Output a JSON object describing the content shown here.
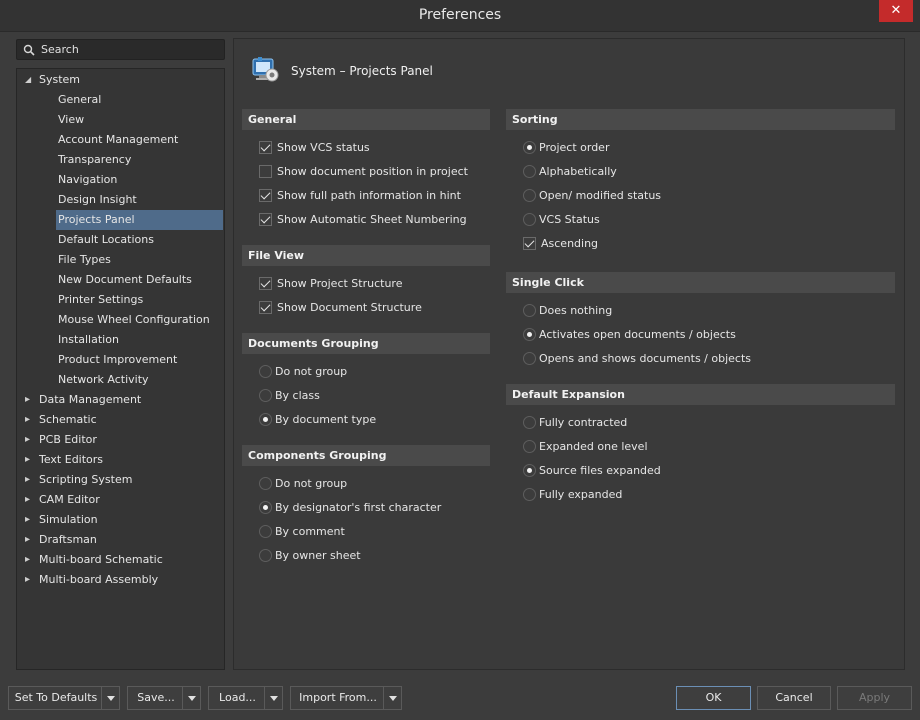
{
  "window": {
    "title": "Preferences",
    "close_glyph": "✕"
  },
  "search": {
    "placeholder": "Search"
  },
  "tree": {
    "system_label": "System",
    "system_children": [
      "General",
      "View",
      "Account Management",
      "Transparency",
      "Navigation",
      "Design Insight",
      "Projects Panel",
      "Default Locations",
      "File Types",
      "New Document Defaults",
      "Printer Settings",
      "Mouse Wheel Configuration",
      "Installation",
      "Product Improvement",
      "Network Activity"
    ],
    "selected": "Projects Panel",
    "top_level": [
      "Data Management",
      "Schematic",
      "PCB Editor",
      "Text Editors",
      "Scripting System",
      "CAM Editor",
      "Simulation",
      "Draftsman",
      "Multi-board Schematic",
      "Multi-board Assembly"
    ]
  },
  "page": {
    "title": "System – Projects Panel",
    "icon": "projects-panel-icon"
  },
  "general": {
    "header": "General",
    "options": [
      {
        "label": "Show VCS status",
        "checked": true
      },
      {
        "label": "Show document position in project",
        "checked": false
      },
      {
        "label": "Show full path information in hint",
        "checked": true
      },
      {
        "label": "Show Automatic Sheet Numbering",
        "checked": true
      }
    ]
  },
  "file_view": {
    "header": "File View",
    "options": [
      {
        "label": "Show Project Structure",
        "checked": true
      },
      {
        "label": "Show Document Structure",
        "checked": true
      }
    ]
  },
  "documents_grouping": {
    "header": "Documents Grouping",
    "options": [
      "Do not group",
      "By class",
      "By document type"
    ],
    "selected": "By document type"
  },
  "components_grouping": {
    "header": "Components Grouping",
    "options": [
      "Do not group",
      "By designator's first character",
      "By comment",
      "By owner sheet"
    ],
    "selected": "By designator's first character"
  },
  "sorting": {
    "header": "Sorting",
    "options": [
      "Project order",
      "Alphabetically",
      "Open/ modified status",
      "VCS Status"
    ],
    "selected": "Project order",
    "ascending_label": "Ascending",
    "ascending": true
  },
  "single_click": {
    "header": "Single Click",
    "options": [
      "Does nothing",
      "Activates open documents / objects",
      "Opens and shows documents / objects"
    ],
    "selected": "Activates open documents / objects"
  },
  "default_expansion": {
    "header": "Default Expansion",
    "options": [
      "Fully contracted",
      "Expanded one level",
      "Source files expanded",
      "Fully expanded"
    ],
    "selected": "Source files expanded"
  },
  "footer": {
    "set_defaults": "Set To Defaults",
    "save": "Save...",
    "load": "Load...",
    "import_from": "Import From...",
    "ok": "OK",
    "cancel": "Cancel",
    "apply": "Apply"
  }
}
